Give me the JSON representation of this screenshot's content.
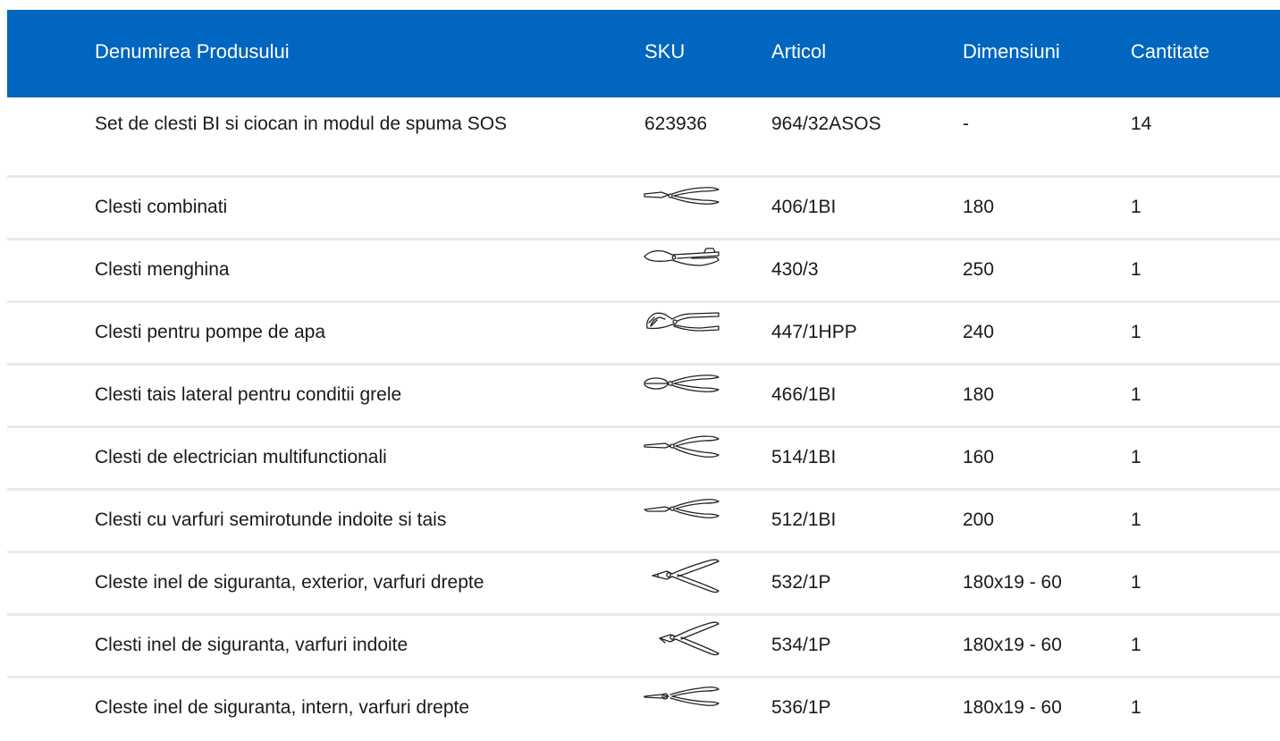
{
  "header": {
    "name": "Denumirea Produsului",
    "sku": "SKU",
    "article": "Articol",
    "dimensions": "Dimensiuni",
    "quantity": "Cantitate"
  },
  "set_row": {
    "name": "Set de clesti BI si ciocan in modul de spuma SOS",
    "sku": "623936",
    "article": "964/32ASOS",
    "dimensions": "-",
    "quantity": "14"
  },
  "items": [
    {
      "name": "Clesti combinati",
      "sku_icon": "combination-pliers-icon",
      "article": "406/1BI",
      "dimensions": "180",
      "quantity": "1"
    },
    {
      "name": "Clesti menghina",
      "sku_icon": "locking-pliers-icon",
      "article": "430/3",
      "dimensions": "250",
      "quantity": "1"
    },
    {
      "name": "Clesti pentru pompe de apa",
      "sku_icon": "water-pump-pliers-icon",
      "article": "447/1HPP",
      "dimensions": "240",
      "quantity": "1"
    },
    {
      "name": "Clesti tais lateral pentru conditii grele",
      "sku_icon": "side-cutter-icon",
      "article": "466/1BI",
      "dimensions": "180",
      "quantity": "1"
    },
    {
      "name": "Clesti de electrician multifunctionali",
      "sku_icon": "electrician-pliers-icon",
      "article": "514/1BI",
      "dimensions": "160",
      "quantity": "1"
    },
    {
      "name": "Clesti cu varfuri semirotunde indoite si tais",
      "sku_icon": "bent-nose-pliers-icon",
      "article": "512/1BI",
      "dimensions": "200",
      "quantity": "1"
    },
    {
      "name": "Cleste inel de siguranta, exterior, varfuri drepte",
      "sku_icon": "circlip-pliers-external-straight-icon",
      "article": "532/1P",
      "dimensions": "180x19 - 60",
      "quantity": "1"
    },
    {
      "name": "Clesti inel de siguranta, varfuri indoite",
      "sku_icon": "circlip-pliers-bent-icon",
      "article": "534/1P",
      "dimensions": "180x19 - 60",
      "quantity": "1"
    },
    {
      "name": "Cleste inel de siguranta, intern, varfuri drepte",
      "sku_icon": "circlip-pliers-internal-straight-icon",
      "article": "536/1P",
      "dimensions": "180x19 - 60",
      "quantity": "1"
    }
  ],
  "colors": {
    "header_bg": "#0066bf",
    "header_text": "#ffffff",
    "row_divider": "#e9e9e9",
    "body_text": "#1a1a1a"
  }
}
